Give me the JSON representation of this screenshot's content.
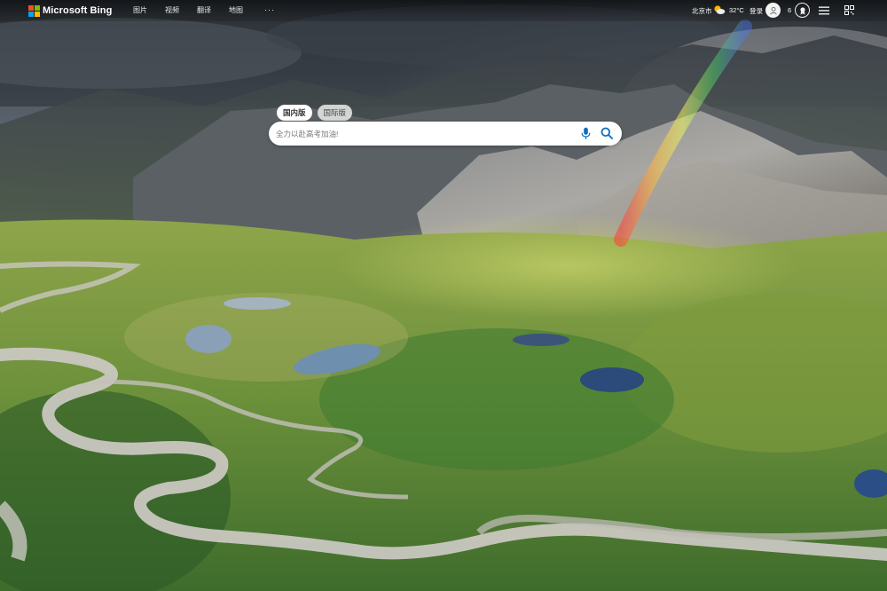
{
  "header": {
    "brand": "Microsoft Bing",
    "nav": [
      {
        "label": "图片"
      },
      {
        "label": "视频"
      },
      {
        "label": "翻译"
      },
      {
        "label": "地图"
      }
    ],
    "more_label": "···",
    "location": "北京市",
    "temperature": "32°C",
    "login_label": "登录",
    "reward_points": "6"
  },
  "search": {
    "tabs": [
      {
        "label": "国内版",
        "active": true
      },
      {
        "label": "国际版",
        "active": false
      }
    ],
    "placeholder": "全力以赴高考加油!"
  },
  "icons": {
    "logo": "microsoft-four-squares",
    "weather": "partly-sunny-icon",
    "avatar": "user-icon",
    "reward": "rewards-medal-icon",
    "menu": "hamburger-menu-icon",
    "qr": "qr-code-icon",
    "mic": "microphone-icon",
    "search": "search-icon"
  },
  "colors": {
    "ms_red": "#f25022",
    "ms_green": "#7fba00",
    "ms_blue": "#00a4ef",
    "ms_yellow": "#ffb900",
    "search_icon": "#0f6cbd"
  }
}
